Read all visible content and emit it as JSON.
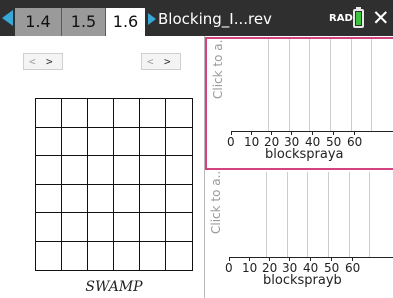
{
  "tabs": [
    "1.4",
    "1.5",
    "1.6"
  ],
  "active_tab_index": 2,
  "document_title": "Blocking_I...rev",
  "angle_mode": "RAD",
  "close_glyph": "✕",
  "sliders": [
    {
      "left_arrow": "<",
      "right_arrow": ">"
    },
    {
      "left_arrow": "<",
      "right_arrow": ">"
    }
  ],
  "grid": {
    "rows": 6,
    "cols": 6
  },
  "swamp_label": "SWAMP",
  "plots": [
    {
      "click_label": "Click to a...",
      "ticks": [
        "0",
        "10",
        "20",
        "30",
        "40",
        "50",
        "60"
      ],
      "axis_title": "blockspraya"
    },
    {
      "click_label": "Click to a...",
      "ticks": [
        "0",
        "10",
        "20",
        "30",
        "40",
        "50",
        "60"
      ],
      "axis_title": "blocksprayb"
    }
  ],
  "colors": {
    "accent": "#38a8d8",
    "selection": "#d4437f",
    "battery": "#3cc23c"
  },
  "icons": {
    "nav_left": "triangle-left-icon",
    "doc": "triangle-right-icon",
    "battery": "battery-icon",
    "close": "close-icon"
  }
}
